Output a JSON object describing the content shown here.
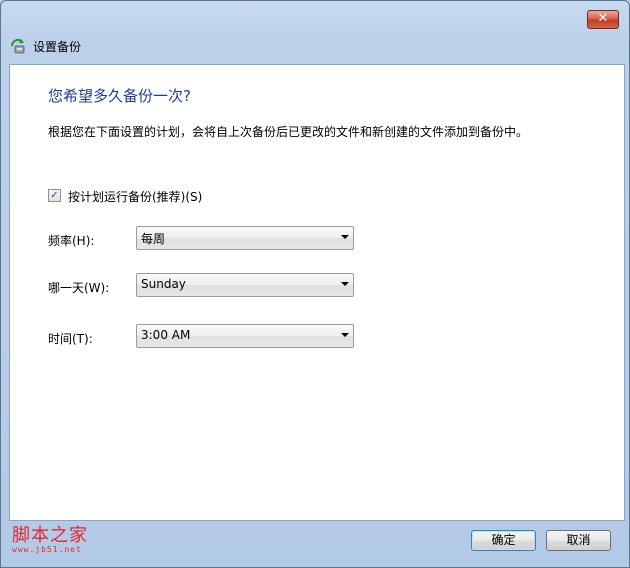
{
  "window": {
    "title": "设置备份",
    "close_glyph": "✕"
  },
  "main": {
    "heading": "您希望多久备份一次?",
    "description": "根据您在下面设置的计划，会将自上次备份后已更改的文件和新创建的文件添加到备份中。",
    "schedule_checkbox": {
      "label": "按计划运行备份(推荐)(S)",
      "checked": true,
      "check_glyph": "✓"
    },
    "fields": [
      {
        "label": "频率(H):",
        "value": "每周"
      },
      {
        "label": "哪一天(W):",
        "value": "Sunday"
      },
      {
        "label": "时间(T):",
        "value": "3:00 AM"
      }
    ]
  },
  "footer": {
    "ok_label": "确定",
    "cancel_label": "取消",
    "watermark": {
      "main": "脚本之家",
      "sub": "www.jb51.net"
    }
  },
  "icons": {
    "app": "backup-icon",
    "close": "close-icon",
    "dropdown": "chevron-down-icon"
  },
  "colors": {
    "heading": "#1c3f95",
    "close_button": "#c13d25",
    "watermark": "#e0282d"
  }
}
